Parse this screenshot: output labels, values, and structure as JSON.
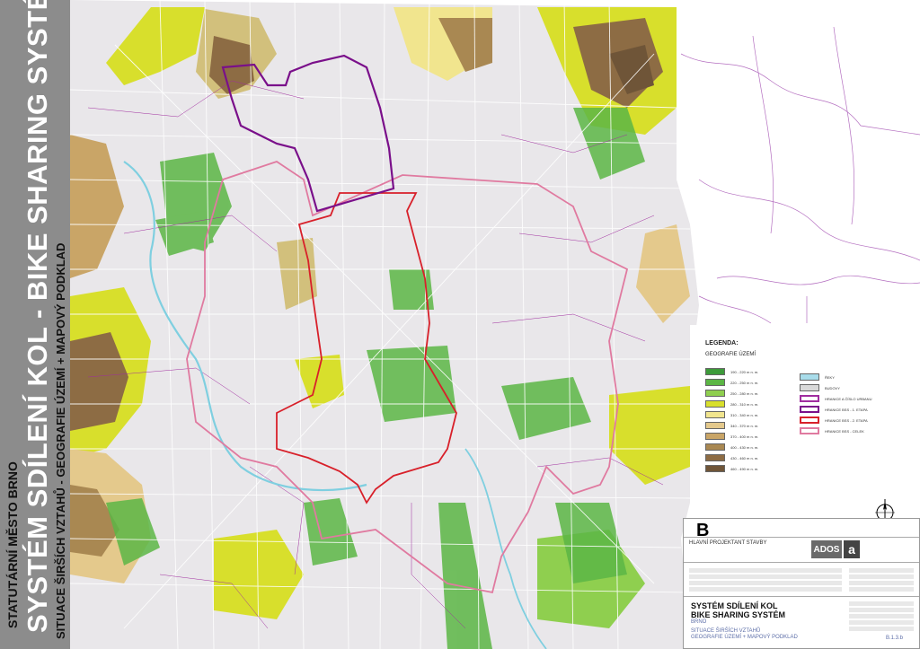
{
  "titles": {
    "city": "STATUTÁRNÍ MĚSTO BRNO",
    "main": "SYSTÉM SDÍLENÍ KOL - BIKE SHARING SYSTÉM",
    "sub": "SITUACE ŠIRŠÍCH VZTAHŮ - GEOGRAFIE ÚZEMÍ + MAPOVÝ PODKLAD"
  },
  "legend": {
    "title": "LEGENDA:",
    "subtitle": "GEOGRAFIE ÚZEMÍ",
    "elevation": [
      {
        "label": "190 - 220 m n. m.",
        "color": "#3d9a3a"
      },
      {
        "label": "220 - 250 m n. m.",
        "color": "#5cb645"
      },
      {
        "label": "250 - 280 m n. m.",
        "color": "#8fcf4f"
      },
      {
        "label": "280 - 310 m n. m.",
        "color": "#d8df2c"
      },
      {
        "label": "310 - 340 m n. m.",
        "color": "#f1e58e"
      },
      {
        "label": "340 - 370 m n. m.",
        "color": "#e4c98c"
      },
      {
        "label": "370 - 400 m n. m.",
        "color": "#c9a567"
      },
      {
        "label": "400 - 430 m n. m.",
        "color": "#a98852"
      },
      {
        "label": "430 - 460 m n. m.",
        "color": "#8d6c44"
      },
      {
        "label": "460 - 490 m n. m.",
        "color": "#6f5538"
      }
    ],
    "items": [
      {
        "label": "ŘEKY",
        "color": "#a8dcea",
        "kind": "fill"
      },
      {
        "label": "BUDOVY",
        "color": "#d9d9d9",
        "kind": "fill"
      },
      {
        "label": "HRANICE A ČÍSLO URBANU",
        "color": "#a02d9f",
        "kind": "line"
      },
      {
        "label": "HRANICE BSS - 1. ETAPA",
        "color": "#7a0f8a",
        "kind": "line"
      },
      {
        "label": "HRANICE BSS - 2. ETAPA",
        "color": "#d8202a",
        "kind": "line"
      },
      {
        "label": "HRANICE BSS - CELEK",
        "color": "#e07aa0",
        "kind": "line"
      }
    ]
  },
  "title_block": {
    "sheet_letter": "B",
    "head_designer": "HLAVNÍ PROJEKTANT STAVBY",
    "company_logo": "ADOS",
    "company_logo_mark": "a",
    "project_line1": "SYSTÉM SDÍLENÍ KOL",
    "project_line2": "BIKE SHARING SYSTÉM",
    "city": "BRNO",
    "drawing_line1": "SITUACE ŠIRŠÍCH VZTAHŮ",
    "drawing_line2": "GEOGRAFIE ÚZEMÍ + MAPOVÝ PODKLAD",
    "drawing_number": "B.1.3.b"
  },
  "colors": {
    "band": "#8c8c8c",
    "urban_border": "#a02d9f",
    "stage1": "#7a0f8a",
    "stage2": "#d8202a",
    "whole": "#e07aa0",
    "river": "#7fcfe0"
  }
}
